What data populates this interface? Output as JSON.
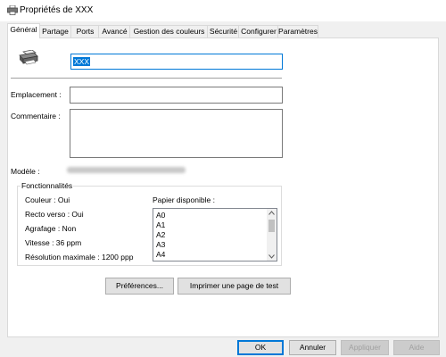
{
  "window": {
    "title": "Propriétés de XXX"
  },
  "tabs": [
    {
      "label": "Général"
    },
    {
      "label": "Partage"
    },
    {
      "label": "Ports"
    },
    {
      "label": "Avancé"
    },
    {
      "label": "Gestion des couleurs"
    },
    {
      "label": "Sécurité"
    },
    {
      "label": "Configurer"
    },
    {
      "label": "Paramètres"
    }
  ],
  "general": {
    "printer_name": "XXX",
    "location_label": "Emplacement :",
    "location_value": "",
    "comment_label": "Commentaire :",
    "comment_value": "",
    "model_label": "Modèle :"
  },
  "features": {
    "title": "Fonctionnalités",
    "color": "Couleur : Oui",
    "duplex": "Recto verso : Oui",
    "staple": "Agrafage : Non",
    "speed": "Vitesse : 36 ppm",
    "resolution": "Résolution maximale : 1200 ppp",
    "paper_label": "Papier disponible :",
    "paper_items": [
      "A0",
      "A1",
      "A2",
      "A3",
      "A4"
    ]
  },
  "buttons": {
    "preferences": "Préférences...",
    "test_page": "Imprimer une page de test",
    "ok": "OK",
    "cancel": "Annuler",
    "apply": "Appliquer",
    "help": "Aide"
  },
  "colors": {
    "accent": "#0078d7",
    "panel": "#ffffff",
    "chrome": "#f0f0f0"
  }
}
